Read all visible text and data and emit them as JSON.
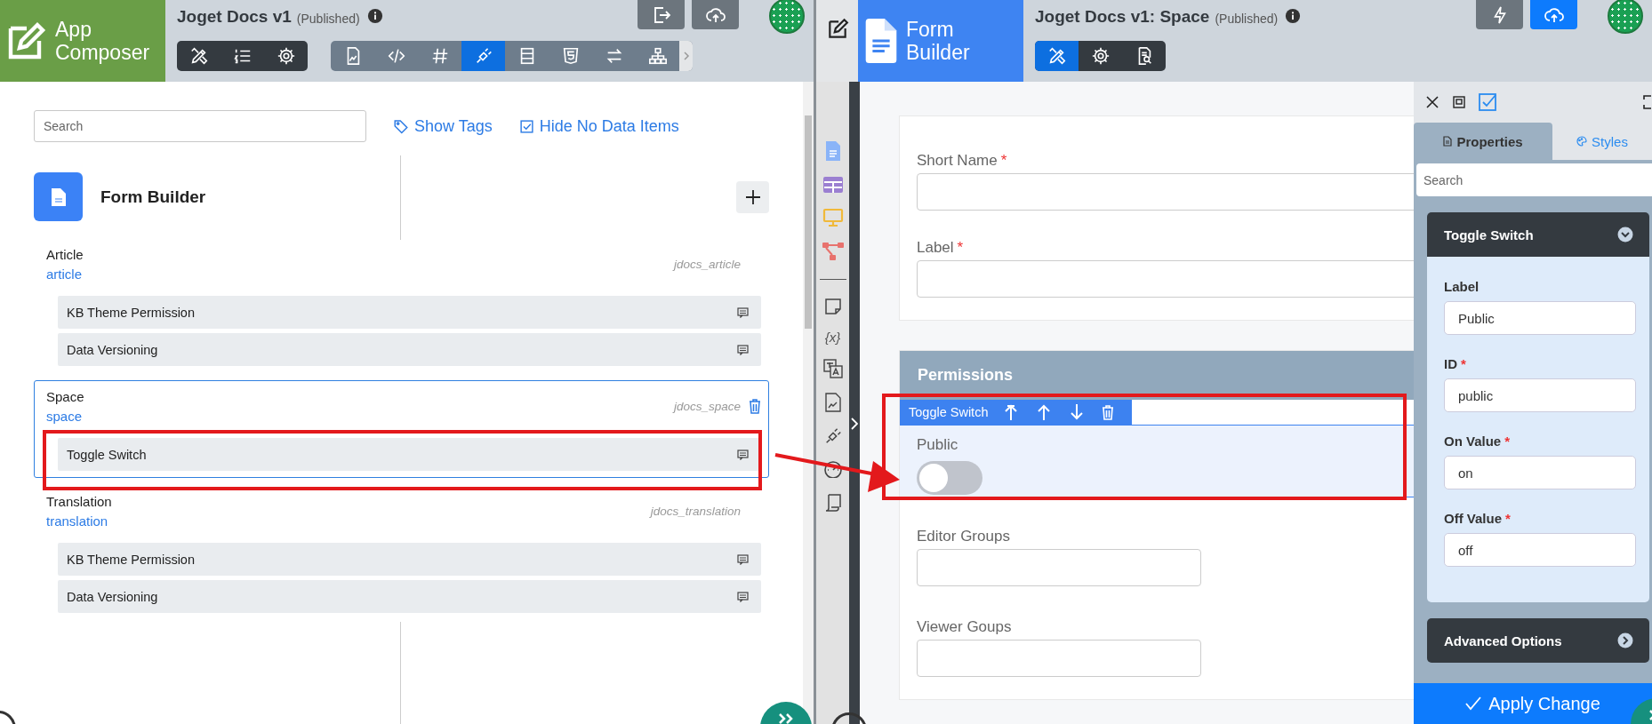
{
  "left": {
    "header": {
      "logo": "App Composer",
      "title": "Joget Docs v1",
      "status": "(Published)",
      "tool_groups": [
        {
          "kind": "dark",
          "tools": [
            {
              "selected": false
            },
            {
              "selected": false
            },
            {
              "selected": false
            }
          ]
        },
        {
          "kind": "light",
          "tools": [
            {
              "selected": false
            },
            {
              "selected": false
            },
            {
              "selected": false
            },
            {
              "selected": true
            },
            {
              "selected": false
            },
            {
              "selected": false
            },
            {
              "selected": false
            },
            {
              "selected": false
            }
          ]
        }
      ]
    },
    "search": {
      "placeholder": "Search"
    },
    "links": [
      "Show Tags",
      "Hide No Data Items"
    ],
    "builder": {
      "title": "Form Builder"
    },
    "groups": [
      {
        "name": "Article",
        "id": "article",
        "table": "jdocs_article",
        "selected": false,
        "items": [
          "KB Theme Permission",
          "Data Versioning"
        ]
      },
      {
        "name": "Space",
        "id": "space",
        "table": "jdocs_space",
        "selected": true,
        "items": [
          "Toggle Switch"
        ]
      },
      {
        "name": "Translation",
        "id": "translation",
        "table": "jdocs_translation",
        "selected": false,
        "items": [
          "KB Theme Permission",
          "Data Versioning"
        ]
      }
    ]
  },
  "right": {
    "header": {
      "logo": "Form Builder",
      "title": "Joget Docs v1: Space",
      "status": "(Published)",
      "tool_groups": [
        {
          "kind": "dark",
          "tools": [
            {
              "selected": true
            },
            {
              "selected": false
            },
            {
              "selected": false
            }
          ]
        }
      ]
    },
    "rail_glyph": "{x}",
    "sections": [
      {
        "fields": [
          {
            "kind": "text",
            "label": "Short Name",
            "required_mark": "*"
          },
          {
            "kind": "text",
            "label": "Label",
            "required_mark": "*"
          }
        ]
      },
      {
        "title": "Permissions",
        "fields": [
          {
            "kind": "toggle",
            "label": "Public",
            "on": false,
            "selected": true,
            "toolbar_label": "Toggle Switch"
          },
          {
            "kind": "short-text",
            "label": "Editor Groups"
          },
          {
            "kind": "short-text",
            "label": "Viewer Goups"
          }
        ]
      }
    ],
    "properties": {
      "tabs": [
        {
          "label": "Properties",
          "selected": true
        },
        {
          "label": "Styles",
          "selected": false
        }
      ],
      "search": {
        "placeholder": "Search"
      },
      "panels": [
        {
          "title": "Toggle Switch",
          "expanded": true,
          "fields": [
            {
              "label": "Label",
              "value": "Public"
            },
            {
              "label": "ID",
              "required_mark": "*",
              "value": "public"
            },
            {
              "label": "On Value",
              "required_mark": "*",
              "value": "on"
            },
            {
              "label": "Off Value",
              "required_mark": "*",
              "value": "off"
            }
          ]
        },
        {
          "title": "Advanced Options",
          "expanded": false
        }
      ],
      "apply_button": "Apply Change"
    }
  }
}
